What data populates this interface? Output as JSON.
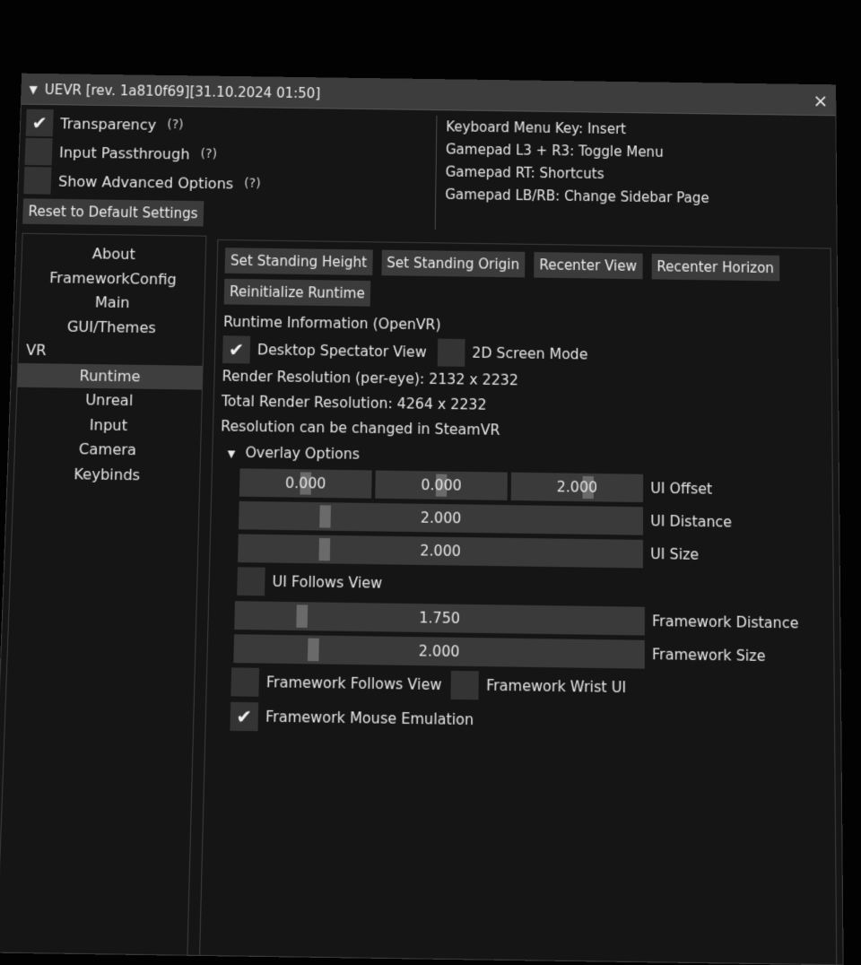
{
  "window": {
    "title": "UEVR [rev. 1a810f69][31.10.2024 01:50]",
    "close_glyph": "×"
  },
  "top": {
    "transparency": {
      "label": "Transparency",
      "checked": true
    },
    "input_passthrough": {
      "label": "Input Passthrough",
      "checked": false
    },
    "show_advanced": {
      "label": "Show Advanced Options",
      "checked": false
    },
    "help_glyph": "(?)",
    "reset_label": "Reset to Default Settings"
  },
  "keyinfo": {
    "lines": [
      "Keyboard Menu Key: Insert",
      "Gamepad L3 + R3: Toggle Menu",
      "Gamepad RT: Shortcuts",
      "Gamepad LB/RB: Change Sidebar Page"
    ]
  },
  "sidebar": {
    "items": [
      "About",
      "FrameworkConfig",
      "Main",
      "GUI/Themes",
      "VR",
      "Runtime",
      "Unreal",
      "Input",
      "Camera",
      "Keybinds"
    ],
    "active": "Runtime"
  },
  "content": {
    "buttons": [
      "Set Standing Height",
      "Set Standing Origin",
      "Recenter View",
      "Recenter Horizon"
    ],
    "reinit_label": "Reinitialize Runtime",
    "runtime_info": "Runtime Information (OpenVR)",
    "desktop_spectator": {
      "label": "Desktop Spectator View",
      "checked": true
    },
    "screen_mode_2d": {
      "label": "2D Screen Mode",
      "checked": false
    },
    "render_res": "Render Resolution (per-eye): 2132 x 2232",
    "total_res": "Total Render Resolution: 4264 x 2232",
    "res_note": "Resolution can be changed in SteamVR",
    "overlay_header": "Overlay Options",
    "ui_offset": {
      "label": "UI Offset",
      "values": [
        "0.000",
        "0.000",
        "2.000"
      ]
    },
    "ui_distance": {
      "label": "UI Distance",
      "value": "2.000",
      "fraction": 0.2
    },
    "ui_size": {
      "label": "UI Size",
      "value": "2.000",
      "fraction": 0.2
    },
    "ui_follows_view": {
      "label": "UI Follows View",
      "checked": false
    },
    "framework_distance": {
      "label": "Framework Distance",
      "value": "1.750",
      "fraction": 0.15
    },
    "framework_size": {
      "label": "Framework Size",
      "value": "2.000",
      "fraction": 0.18
    },
    "framework_follows_view": {
      "label": "Framework Follows View",
      "checked": false
    },
    "framework_wrist_ui": {
      "label": "Framework Wrist UI",
      "checked": false
    },
    "framework_mouse_emulation": {
      "label": "Framework Mouse Emulation",
      "checked": true
    }
  },
  "icons": {
    "check": "✔",
    "collapse_triangle": "▼"
  }
}
